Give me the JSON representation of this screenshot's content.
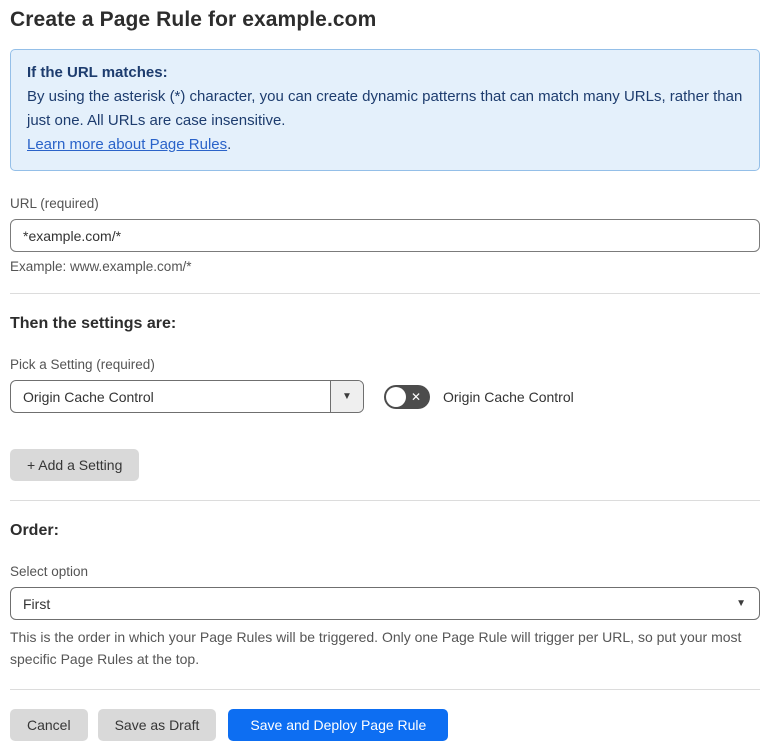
{
  "page": {
    "title": "Create a Page Rule for example.com"
  },
  "info_box": {
    "heading": "If the URL matches:",
    "body": "By using the asterisk (*) character, you can create dynamic patterns that can match many URLs, rather than just one. All URLs are case insensitive.",
    "link_label": "Learn more about Page Rules",
    "link_suffix": "."
  },
  "url_field": {
    "label": "URL (required)",
    "value": "*example.com/*",
    "hint": "Example: www.example.com/*"
  },
  "settings_section": {
    "heading": "Then the settings are:",
    "picker_label": "Pick a Setting (required)",
    "picker_value": "Origin Cache Control",
    "toggle_label": "Origin Cache Control",
    "toggle_state": "off",
    "add_setting_label": "+ Add a Setting"
  },
  "order_section": {
    "heading": "Order:",
    "select_label": "Select option",
    "select_value": "First",
    "help_text": "This is the order in which your Page Rules will be triggered. Only one Page Rule will trigger per URL, so put your most specific Page Rules at the top."
  },
  "footer": {
    "cancel_label": "Cancel",
    "save_draft_label": "Save as Draft",
    "save_deploy_label": "Save and Deploy Page Rule"
  },
  "icons": {
    "dropdown_arrow_glyph": "▼",
    "toggle_off_glyph": "✕"
  },
  "colors": {
    "accent_blue": "#0d6ef2",
    "info_bg": "#e4f0fb",
    "info_border": "#94bfe8",
    "info_text": "#1d3c6e",
    "link_blue": "#2a63c9",
    "toggle_off_bg": "#4c4c4c",
    "button_gray": "#d9d9d9"
  }
}
